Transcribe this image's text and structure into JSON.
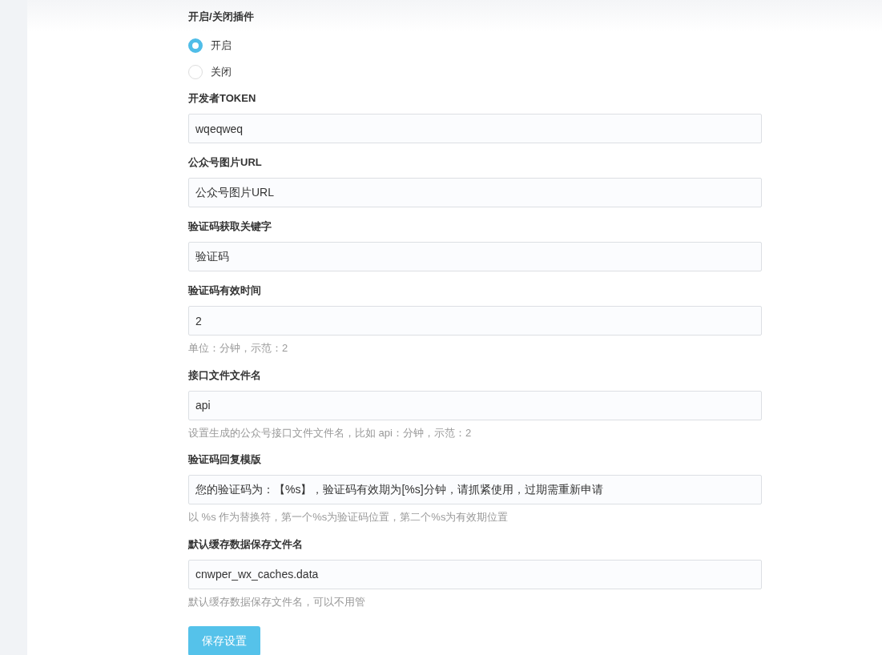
{
  "plugin_switch": {
    "label": "开启/关闭插件",
    "options": [
      {
        "label": "开启",
        "selected": true
      },
      {
        "label": "关闭",
        "selected": false
      }
    ]
  },
  "fields": [
    {
      "label": "开发者TOKEN",
      "value": "wqeqweq"
    },
    {
      "label": "公众号图片URL",
      "value": "公众号图片URL"
    },
    {
      "label": "验证码获取关键字",
      "value": "验证码"
    },
    {
      "label": "验证码有效时间",
      "value": "2",
      "help": "单位：分钟，示范：2"
    },
    {
      "label": "接口文件文件名",
      "value": "api",
      "help": "设置生成的公众号接口文件文件名，比如 api：分钟，示范：2"
    },
    {
      "label": "验证码回复模版",
      "value": "您的验证码为：【%s】，验证码有效期为[%s]分钟，请抓紧使用，过期需重新申请",
      "help": "以 %s 作为替换符，第一个%s为验证码位置，第二个%s为有效期位置"
    },
    {
      "label": "默认缓存数据保存文件名",
      "value": "cnwper_wx_caches.data",
      "help": "默认缓存数据保存文件名，可以不用管"
    }
  ],
  "save_button": "保存设置"
}
